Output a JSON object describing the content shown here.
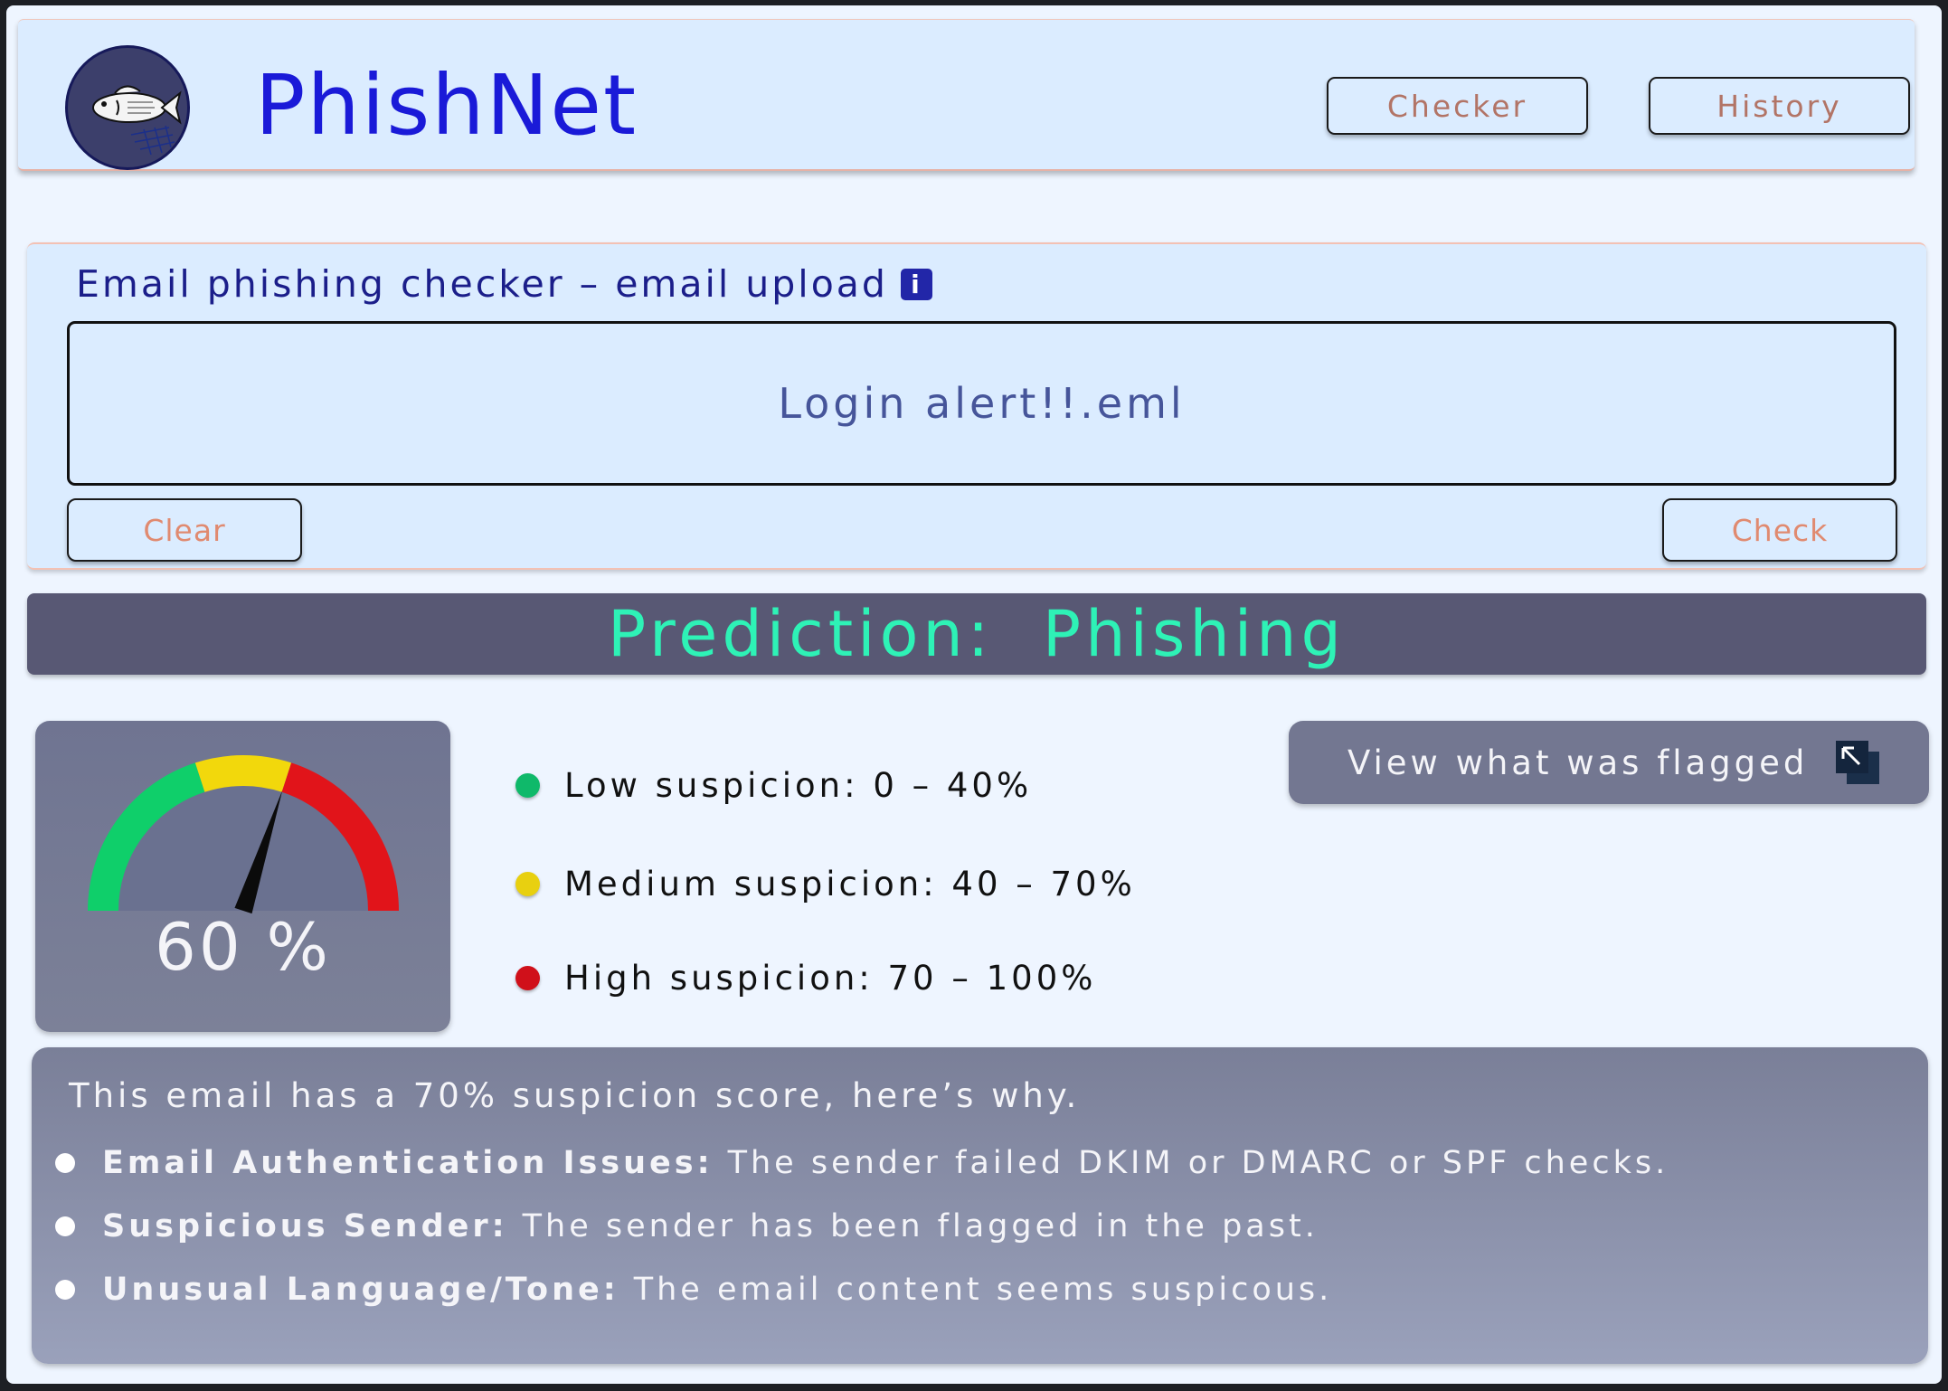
{
  "header": {
    "app_name": "PhishNet",
    "logo_icon": "fish-net-logo-icon",
    "nav": {
      "checker_label": "Checker",
      "history_label": "History"
    }
  },
  "upload": {
    "title": "Email phishing checker – email upload",
    "info_icon_glyph": "i",
    "file_name": "Login alert!!.eml",
    "clear_label": "Clear",
    "check_label": "Check"
  },
  "prediction": {
    "text": "Prediction:  Phishing"
  },
  "gauge": {
    "value_text": "60 %",
    "value_fraction": 0.6,
    "segment_colors": [
      "#0fcf6a",
      "#f2d80c",
      "#e1141a"
    ]
  },
  "legend": {
    "low": {
      "label": "Low suspicion: 0 – 40%",
      "color": "#0fb96a"
    },
    "medium": {
      "label": "Medium suspicion: 40 – 70%",
      "color": "#e8d010"
    },
    "high": {
      "label": "High suspicion: 70 – 100%",
      "color": "#d0101a"
    }
  },
  "flagged": {
    "label": "View what was flagged",
    "icon": "expand-arrow-icon"
  },
  "explanation": {
    "summary": "This email has a 70% suspicion score, here’s why.",
    "reasons": [
      {
        "title": "Email Authentication Issues:",
        "text": "The sender failed DKIM or DMARC or SPF checks."
      },
      {
        "title": "Suspicious Sender:",
        "text": "The sender has been flagged in the past."
      },
      {
        "title": "Unusual Language/Tone:",
        "text": "The email content seems suspicous."
      }
    ]
  }
}
